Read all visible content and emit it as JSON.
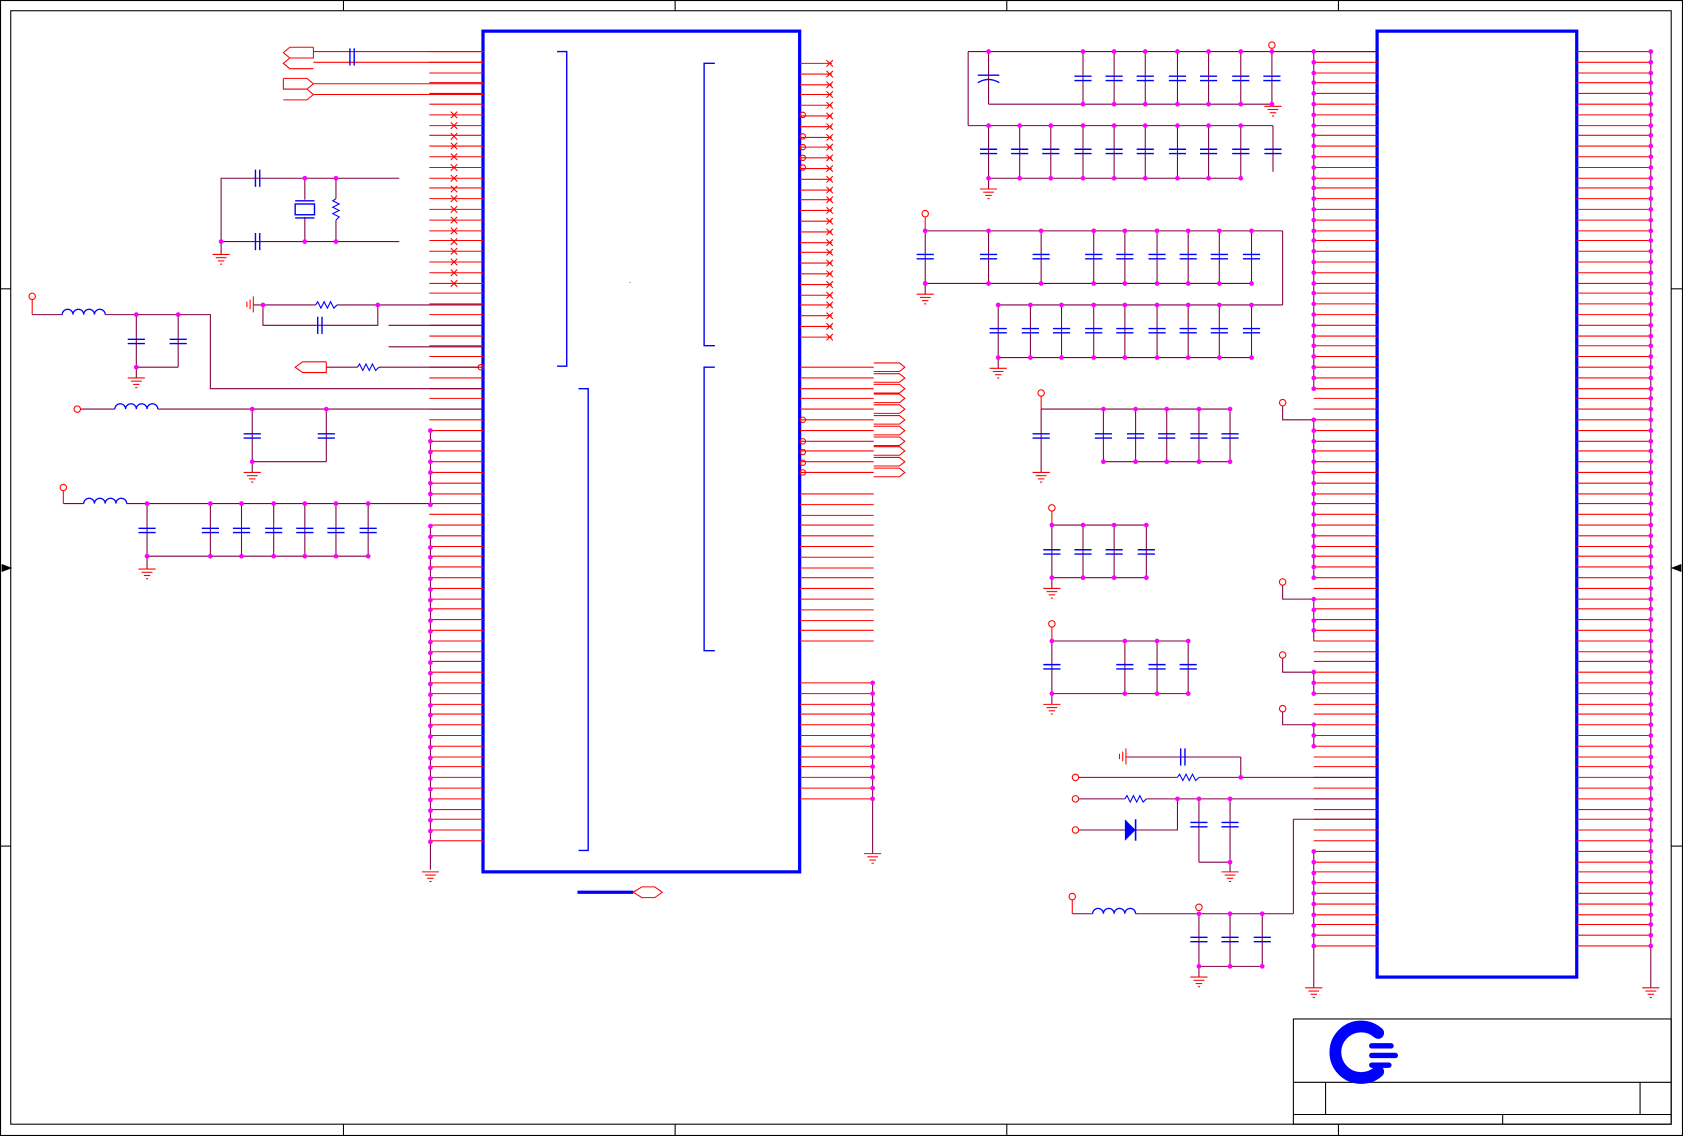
{
  "sheet": {
    "frame_color": "#000000",
    "symbol_color": "#0000ff",
    "wire_color": "#800040",
    "pin_color": "#ff0000",
    "junction_color": "#ff00ff"
  },
  "title_block": {
    "logo": "company-logo-icon"
  }
}
